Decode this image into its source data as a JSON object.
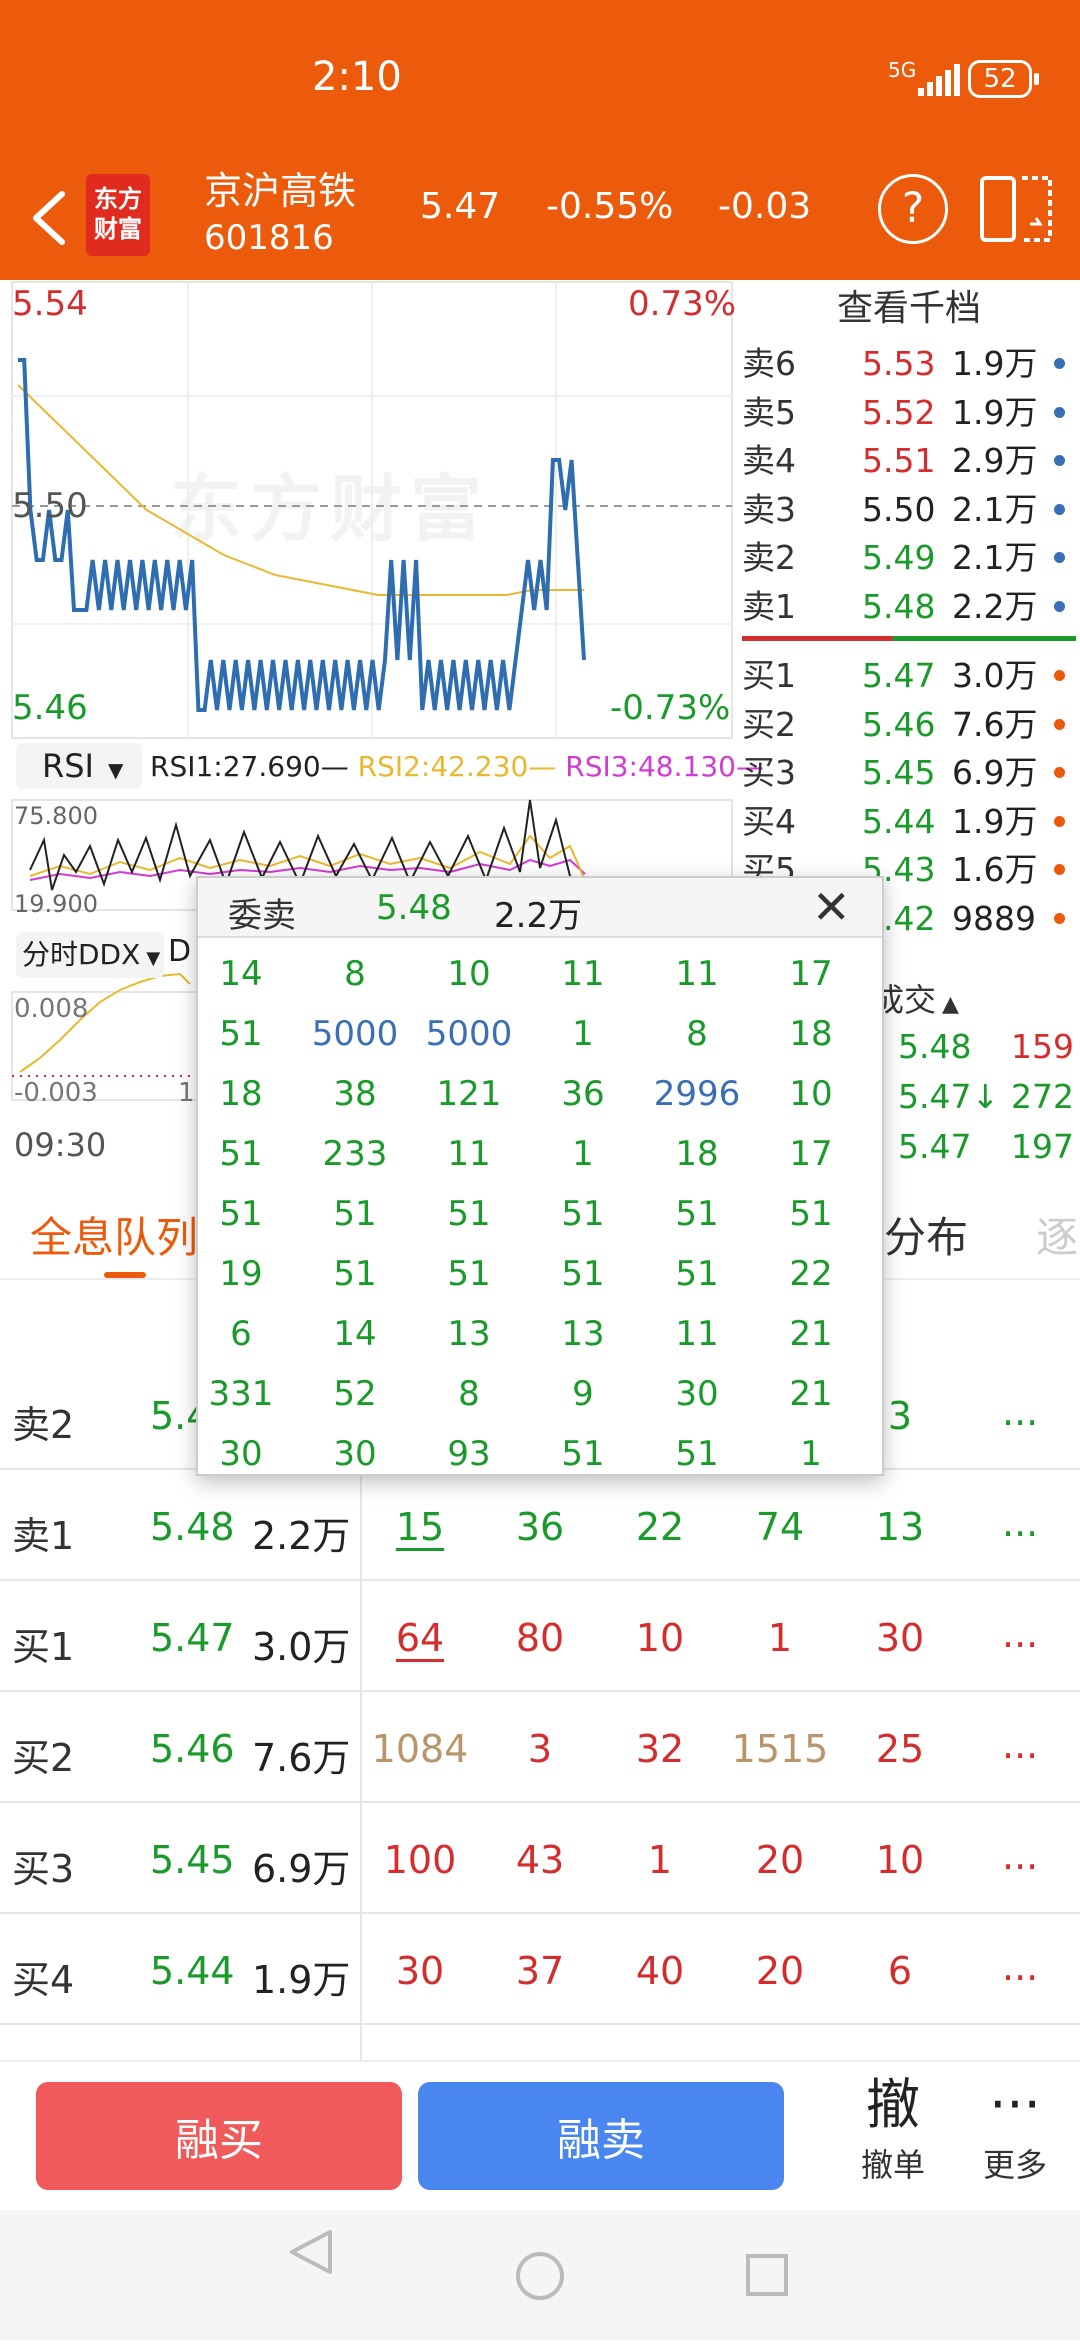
{
  "status": {
    "time": "2:10",
    "network": "5G",
    "battery": "52"
  },
  "header": {
    "logo_line1": "东方",
    "logo_line2": "财富",
    "name": "京沪高铁",
    "code": "601816",
    "price": "5.47",
    "pct": "-0.55%",
    "change": "-0.03"
  },
  "chart": {
    "watermark": "东方财富",
    "price_high": "5.54",
    "price_mid": "5.50",
    "price_low": "5.46",
    "pct_high": "0.73%",
    "pct_low": "-0.73%",
    "rsi_select": "RSI",
    "rsi1": "RSI1:27.690",
    "rsi2": "RSI2:42.230",
    "rsi3": "RSI3:48.130",
    "rsi_high": "75.800",
    "rsi_low": "19.900",
    "ddx_select": "分时DDX",
    "ddx_d": "D",
    "ddx_high": "0.008",
    "ddx_low": "-0.003",
    "ddx_mid": "1",
    "start_time": "09:30",
    "price_line": [
      5.53,
      5.53,
      5.5,
      5.49,
      5.49,
      5.5,
      5.49,
      5.49,
      5.5,
      5.48,
      5.48,
      5.48,
      5.49,
      5.48,
      5.49,
      5.48,
      5.49,
      5.48,
      5.49,
      5.48,
      5.49,
      5.48,
      5.49,
      5.48,
      5.49,
      5.48,
      5.49,
      5.48,
      5.49,
      5.46,
      5.46,
      5.47,
      5.46,
      5.47,
      5.46,
      5.47,
      5.46,
      5.47,
      5.46,
      5.47,
      5.46,
      5.47,
      5.46,
      5.47,
      5.46,
      5.47,
      5.46,
      5.47,
      5.46,
      5.47,
      5.46,
      5.47,
      5.46,
      5.47,
      5.46,
      5.47,
      5.46,
      5.47,
      5.46,
      5.47,
      5.49,
      5.47,
      5.49,
      5.47,
      5.49,
      5.46,
      5.47,
      5.46,
      5.47,
      5.46,
      5.47,
      5.46,
      5.47,
      5.46,
      5.47,
      5.46,
      5.47,
      5.46,
      5.47,
      5.46,
      5.47,
      5.48,
      5.49,
      5.48,
      5.49,
      5.48,
      5.51,
      5.51,
      5.5,
      5.51,
      5.49,
      5.47
    ],
    "avg_line": [
      5.525,
      5.52,
      5.515,
      5.51,
      5.505,
      5.5,
      5.497,
      5.494,
      5.491,
      5.489,
      5.487,
      5.486,
      5.485,
      5.484,
      5.483,
      5.483,
      5.483,
      5.483,
      5.483,
      5.483,
      5.484,
      5.484,
      5.484
    ]
  },
  "orderbook": {
    "title": "查看千档",
    "asks": [
      {
        "label": "卖6",
        "price": "5.53",
        "vol": "1.9万",
        "pc": "red"
      },
      {
        "label": "卖5",
        "price": "5.52",
        "vol": "1.9万",
        "pc": "red"
      },
      {
        "label": "卖4",
        "price": "5.51",
        "vol": "2.9万",
        "pc": "red"
      },
      {
        "label": "卖3",
        "price": "5.50",
        "vol": "2.1万",
        "pc": ""
      },
      {
        "label": "卖2",
        "price": "5.49",
        "vol": "2.1万",
        "pc": "green"
      },
      {
        "label": "卖1",
        "price": "5.48",
        "vol": "2.2万",
        "pc": "green"
      }
    ],
    "bids": [
      {
        "label": "买1",
        "price": "5.47",
        "vol": "3.0万"
      },
      {
        "label": "买2",
        "price": "5.46",
        "vol": "7.6万"
      },
      {
        "label": "买3",
        "price": "5.45",
        "vol": "6.9万"
      },
      {
        "label": "买4",
        "price": "5.44",
        "vol": "1.9万"
      },
      {
        "label": "买5",
        "price": "5.43",
        "vol": "1.6万"
      },
      {
        "label": "买6",
        "price": "5.42",
        "vol": "9889"
      }
    ],
    "ask_dot_color": "#3a6eb5",
    "bid_dot_color": "#ec5a0b"
  },
  "trades": {
    "title": "分时成交",
    "rows": [
      {
        "price": "5.48",
        "vol": "159",
        "pc": "green",
        "vc": "red"
      },
      {
        "price": "5.47↓",
        "vol": "272",
        "pc": "green",
        "vc": "green"
      },
      {
        "price": "5.47",
        "vol": "197",
        "pc": "green",
        "vc": "green"
      }
    ]
  },
  "tabs": {
    "queue": "全息队列",
    "dist": "分布",
    "next": "逐"
  },
  "queue": {
    "rows": [
      {
        "label": "卖2",
        "price": "5.49",
        "vol": "",
        "cells": [
          "",
          "",
          "",
          "",
          "3"
        ],
        "cc": [
          "green",
          "green",
          "green",
          "green",
          "green"
        ]
      },
      {
        "label": "卖1",
        "price": "5.48",
        "vol": "2.2万",
        "cells": [
          "15",
          "36",
          "22",
          "74",
          "13"
        ],
        "cc": [
          "green",
          "green",
          "green",
          "green",
          "green"
        ],
        "ul": true
      },
      {
        "label": "买1",
        "price": "5.47",
        "vol": "3.0万",
        "cells": [
          "64",
          "80",
          "10",
          "1",
          "30"
        ],
        "cc": [
          "red",
          "red",
          "red",
          "red",
          "red"
        ],
        "ul": true
      },
      {
        "label": "买2",
        "price": "5.46",
        "vol": "7.6万",
        "cells": [
          "1084",
          "3",
          "32",
          "1515",
          "25"
        ],
        "cc": [
          "tan",
          "red",
          "red",
          "tan",
          "red"
        ]
      },
      {
        "label": "买3",
        "price": "5.45",
        "vol": "6.9万",
        "cells": [
          "100",
          "43",
          "1",
          "20",
          "10"
        ],
        "cc": [
          "red",
          "red",
          "red",
          "red",
          "red"
        ]
      },
      {
        "label": "买4",
        "price": "5.44",
        "vol": "1.9万",
        "cells": [
          "30",
          "37",
          "40",
          "20",
          "6"
        ],
        "cc": [
          "red",
          "red",
          "red",
          "red",
          "red"
        ]
      }
    ],
    "more": "..."
  },
  "popup": {
    "label": "委卖",
    "price": "5.48",
    "vol": "2.2万",
    "close": "✕",
    "grid": [
      [
        "14",
        "8",
        "10",
        "11",
        "11",
        "17"
      ],
      [
        "51",
        "5000",
        "5000",
        "1",
        "8",
        "18"
      ],
      [
        "18",
        "38",
        "121",
        "36",
        "2996",
        "10"
      ],
      [
        "51",
        "233",
        "11",
        "1",
        "18",
        "17"
      ],
      [
        "51",
        "51",
        "51",
        "51",
        "51",
        "51"
      ],
      [
        "19",
        "51",
        "51",
        "51",
        "51",
        "22"
      ],
      [
        "6",
        "14",
        "13",
        "13",
        "11",
        "21"
      ],
      [
        "331",
        "52",
        "8",
        "9",
        "30",
        "21"
      ],
      [
        "30",
        "30",
        "93",
        "51",
        "51",
        "1"
      ]
    ],
    "blue_cells": [
      "5000",
      "2996"
    ]
  },
  "bottom": {
    "buy": "融买",
    "sell": "融卖",
    "cancel_icon": "撤",
    "cancel": "撤单",
    "more_icon": "···",
    "more": "更多"
  }
}
